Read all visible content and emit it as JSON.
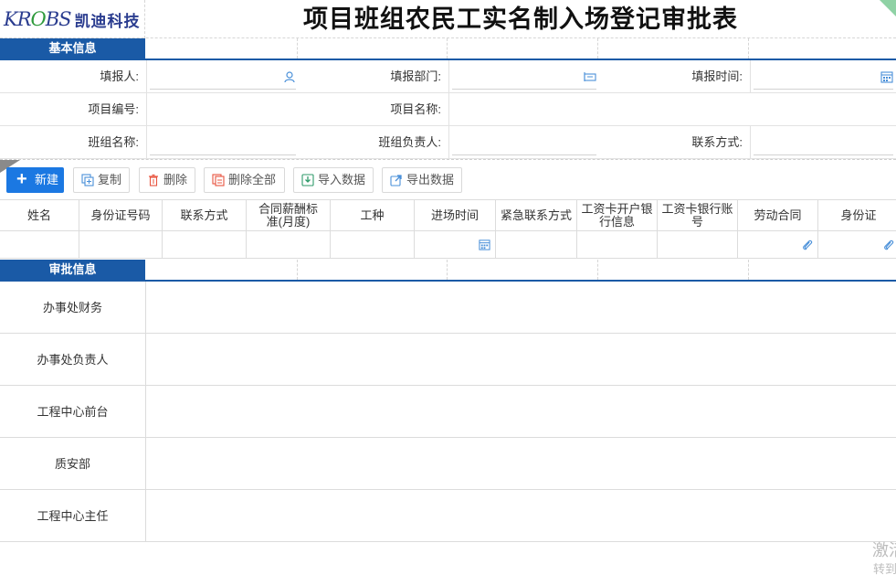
{
  "brand": {
    "logo_mark_a": "K",
    "logo_mark_b": "R",
    "logo_mark_c": "O",
    "logo_mark_d": "BS",
    "logo_name": "凯迪科技"
  },
  "page_title": "项目班组农民工实名制入场登记审批表",
  "basic_section": {
    "label": "基本信息"
  },
  "form": {
    "reporter_label": "填报人:",
    "dept_label": "填报部门:",
    "time_label": "填报时间:",
    "project_no_label": "项目编号:",
    "project_name_label": "项目名称:",
    "team_name_label": "班组名称:",
    "team_leader_label": "班组负责人:",
    "contact_label": "联系方式:"
  },
  "toolbar": {
    "new_label": "新建",
    "copy_label": "复制",
    "delete_label": "删除",
    "delete_all_label": "删除全部",
    "import_label": "导入数据",
    "export_label": "导出数据"
  },
  "grid": {
    "columns": [
      "姓名",
      "身份证号码",
      "联系方式",
      "合同薪酬标准(月度)",
      "工种",
      "进场时间",
      "紧急联系方式",
      "工资卡开户银行信息",
      "工资卡银行账号",
      "劳动合同",
      "身份证"
    ]
  },
  "approval_section": {
    "label": "审批信息"
  },
  "approvals": [
    "办事处财务",
    "办事处负责人",
    "工程中心前台",
    "质安部",
    "工程中心主任"
  ],
  "watermark": {
    "line1": "激活",
    "line2": "转到"
  },
  "colors": {
    "accent": "#1a5aa6",
    "primary_button": "#1b78e2"
  },
  "icons": {
    "reporter": "user-icon",
    "dept": "org-icon",
    "time": "calendar-icon",
    "grid_entry_time": "calendar-icon",
    "grid_contract": "paperclip-icon",
    "grid_idcard": "paperclip-icon"
  }
}
